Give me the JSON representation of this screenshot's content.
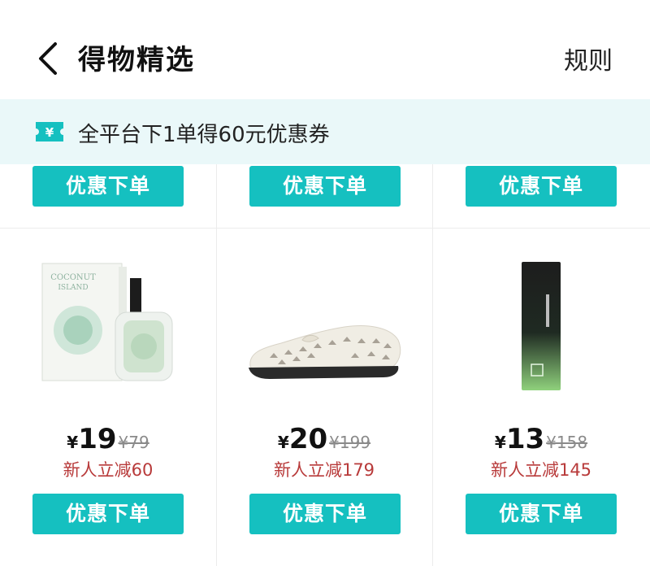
{
  "header": {
    "title": "得物精选",
    "rules_label": "规则"
  },
  "coupon_banner": {
    "icon_glyph": "¥",
    "text": "全平台下1单得60元优惠券"
  },
  "top_row_buttons": [
    {
      "label": "优惠下单"
    },
    {
      "label": "优惠下单"
    },
    {
      "label": "优惠下单"
    }
  ],
  "products": [
    {
      "image": "perfume-box-and-bottle",
      "box_text": [
        "COCONUT",
        "ISLAND"
      ],
      "currency": "¥",
      "price": "19",
      "original_price": "¥79",
      "discount": "新人立减60",
      "button_label": "优惠下单"
    },
    {
      "image": "white-perforated-flat-shoe",
      "currency": "¥",
      "price": "20",
      "original_price": "¥199",
      "discount": "新人立减179",
      "button_label": "优惠下单"
    },
    {
      "image": "dark-green-skincare-bottle",
      "currency": "¥",
      "price": "13",
      "original_price": "¥158",
      "discount": "新人立减145",
      "button_label": "优惠下单"
    }
  ],
  "colors": {
    "accent": "#15c0c0",
    "banner_bg": "#eaf8f9",
    "discount_text": "#b83a3a"
  }
}
